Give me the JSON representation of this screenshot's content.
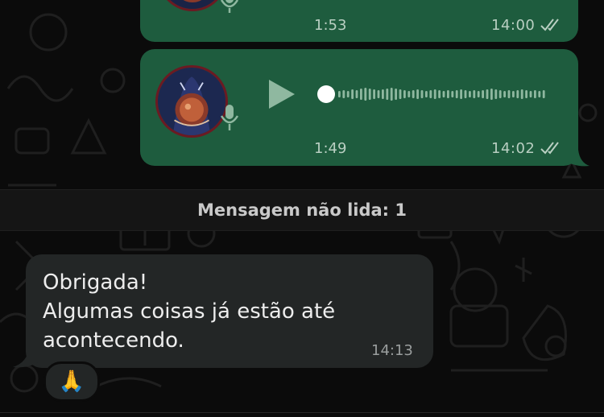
{
  "messages": {
    "voice_1": {
      "duration": "1:53",
      "time": "14:00",
      "status": "read"
    },
    "voice_2": {
      "duration": "1:49",
      "time": "14:02",
      "status": "read",
      "progress": 0
    },
    "incoming": {
      "lines": [
        "Obrigada!",
        "Algumas coisas já estão até",
        "acontecendo."
      ],
      "time": "14:13",
      "reaction": "🙏"
    }
  },
  "unread_banner": "Mensagem não lida: 1",
  "icons": {
    "mic": "microphone-icon",
    "play": "play-icon",
    "ticks": "double-check-icon"
  },
  "colors": {
    "outgoing_bubble": "#1e5c3e",
    "incoming_bubble": "#232626",
    "background": "#0b0b0b",
    "read_ticks": "#b9cfc2"
  }
}
